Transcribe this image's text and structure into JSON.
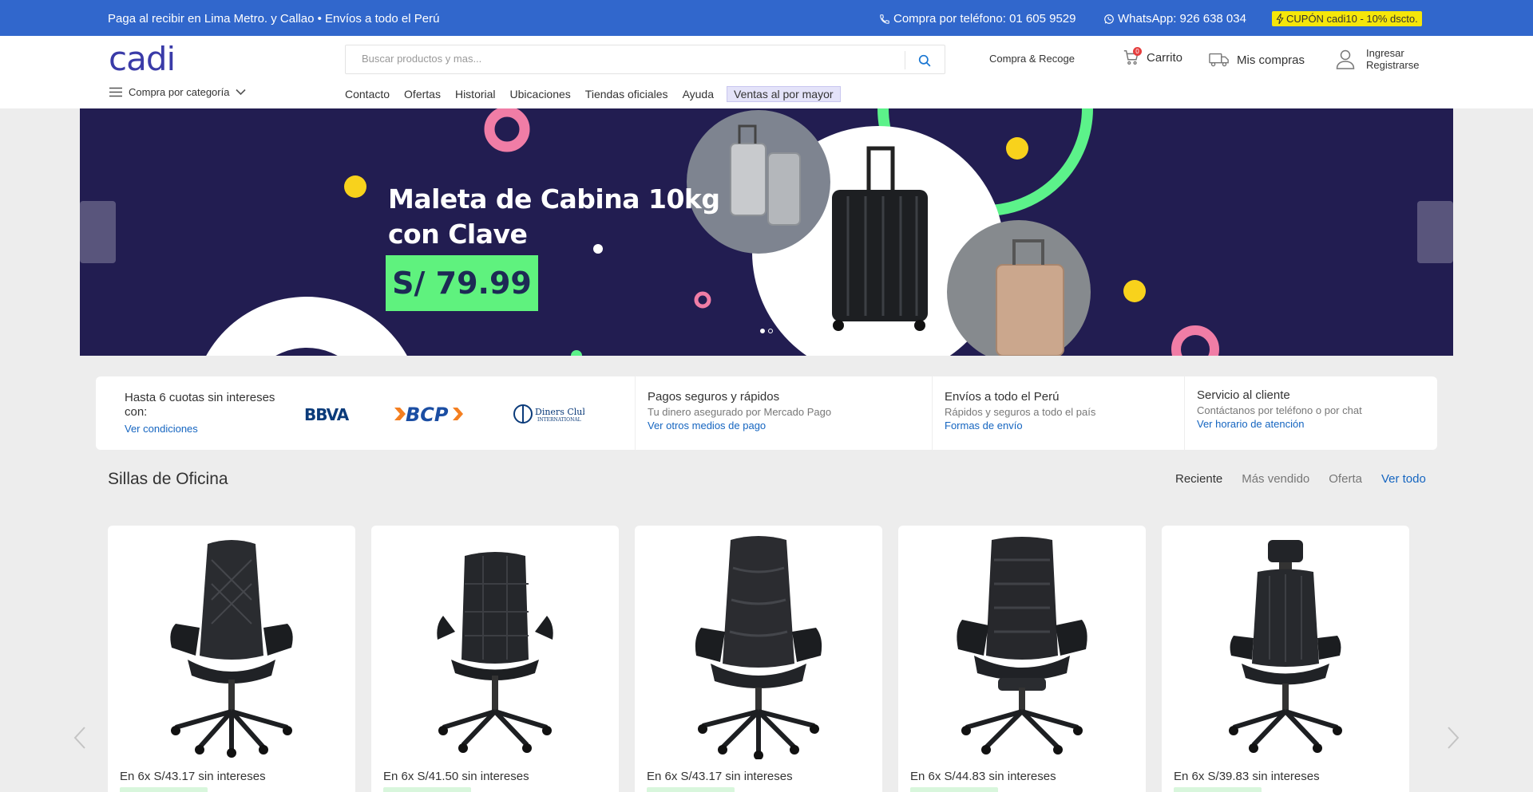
{
  "topbar": {
    "message": "Paga al recibir en Lima Metro. y Callao • Envíos a todo el Perú",
    "phone": "Compra por teléfono: 01 605 9529",
    "whatsapp": "WhatsApp: 926 638 034",
    "coupon": "CUPÓN cadi10 - 10% dscto.",
    "icons": [
      "phone-icon",
      "whatsapp-icon",
      "bolt-icon"
    ]
  },
  "header": {
    "logo": "cadi",
    "search_placeholder": "Buscar productos y mas...",
    "compra_recoge": "Compra & Recoge",
    "cart_label": "Carrito",
    "cart_count": "0",
    "mis_compras": "Mis compras",
    "login": "Ingresar",
    "register": "Registrarse",
    "category_toggle": "Compra por categoría",
    "brand_color": "#3167cc"
  },
  "nav": {
    "items": [
      "Contacto",
      "Ofertas",
      "Historial",
      "Ubicaciones",
      "Tiendas oficiales",
      "Ayuda"
    ],
    "wholesale": "Ventas al por mayor"
  },
  "hero": {
    "title_line1": "Maleta de Cabina 10kg",
    "title_line2": "con Clave",
    "price": "S/ 79.99",
    "slides": 2,
    "active_slide": 1
  },
  "benefits": {
    "installments": {
      "title": "Hasta 6 cuotas sin intereses con:",
      "link": "Ver condiciones",
      "banks": [
        "BBVA",
        "BCP",
        "Diners Club International"
      ]
    },
    "payments": {
      "title": "Pagos seguros y rápidos",
      "subtitle": "Tu dinero asegurado por Mercado Pago",
      "link": "Ver otros medios de pago"
    },
    "shipping": {
      "title": "Envíos a todo el Perú",
      "subtitle": "Rápidos y seguros a todo el país",
      "link": "Formas de envío"
    },
    "service": {
      "title": "Servicio al cliente",
      "subtitle": "Contáctanos por teléfono o por chat",
      "link": "Ver horario de atención"
    }
  },
  "section": {
    "title": "Sillas de Oficina",
    "tabs": [
      "Reciente",
      "Más vendido",
      "Oferta"
    ],
    "active_tab": "Reciente",
    "view_all": "Ver todo"
  },
  "products": [
    {
      "installments": "En 6x S/43.17 sin intereses"
    },
    {
      "installments": "En 6x S/41.50 sin intereses"
    },
    {
      "installments": "En 6x S/43.17 sin intereses"
    },
    {
      "installments": "En 6x S/44.83 sin intereses"
    },
    {
      "installments": "En 6x S/39.83 sin intereses"
    }
  ]
}
